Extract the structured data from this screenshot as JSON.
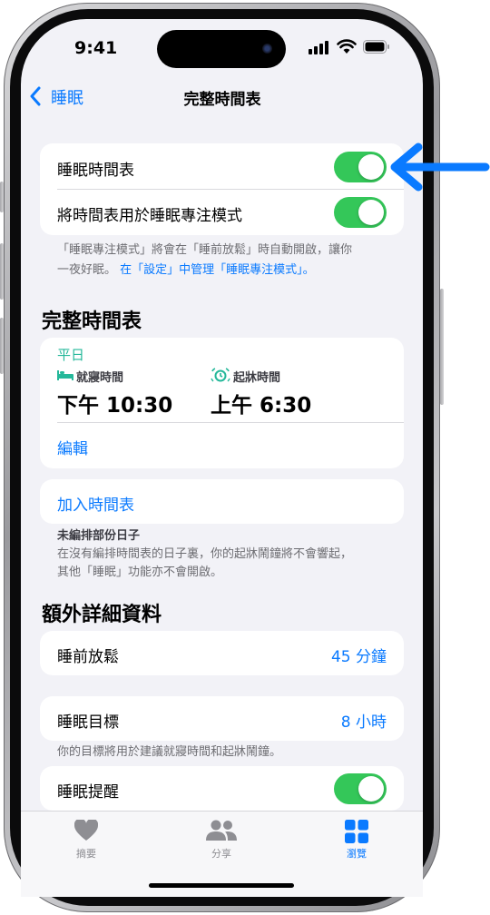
{
  "status_bar": {
    "time": "9:41"
  },
  "nav": {
    "back_label": "睡眠",
    "title": "完整時間表"
  },
  "toggles_card": {
    "rows": [
      {
        "label": "睡眠時間表",
        "on": true
      },
      {
        "label": "將時間表用於睡眠專注模式",
        "on": true
      }
    ]
  },
  "focus_note": {
    "line1": "「睡眠專注模式」將會在「睡前放鬆」時自動開啟，讓你",
    "line2_plain": "一夜好眠。",
    "line2_link": "在「設定」中管理「睡眠專注模式」。"
  },
  "full_schedule": {
    "section_title": "完整時間表",
    "days": "平日",
    "bedtime_label": "就寢時間",
    "bedtime_value": "下午 10:30",
    "wake_label": "起牀時間",
    "wake_value": "上午 6:30",
    "edit_label": "編輯",
    "add_label": "加入時間表",
    "unscheduled_title": "未編排部份日子",
    "unscheduled_line1": "在沒有編排時間表的日子裏，你的起牀鬧鐘將不會響起，",
    "unscheduled_line2": "其他「睡眠」功能亦不會開啟。"
  },
  "details": {
    "section_title": "額外詳細資料",
    "wind_down_label": "睡前放鬆",
    "wind_down_value": "45 分鐘",
    "sleep_goal_label": "睡眠目標",
    "sleep_goal_value": "8 小時",
    "goal_note": "你的目標將用於建議就寢時間和起牀鬧鐘。",
    "reminder_label": "睡眠提醒",
    "reminder_on": true
  },
  "tabbar": {
    "items": [
      {
        "label": "摘要",
        "icon": "heart-icon",
        "active": false
      },
      {
        "label": "分享",
        "icon": "people-icon",
        "active": false
      },
      {
        "label": "瀏覽",
        "icon": "grid-icon",
        "active": true
      }
    ]
  },
  "colors": {
    "accent": "#0a7aff",
    "toggle_on": "#34c759",
    "teal": "#25b89a",
    "arrow": "#0a7aff"
  }
}
